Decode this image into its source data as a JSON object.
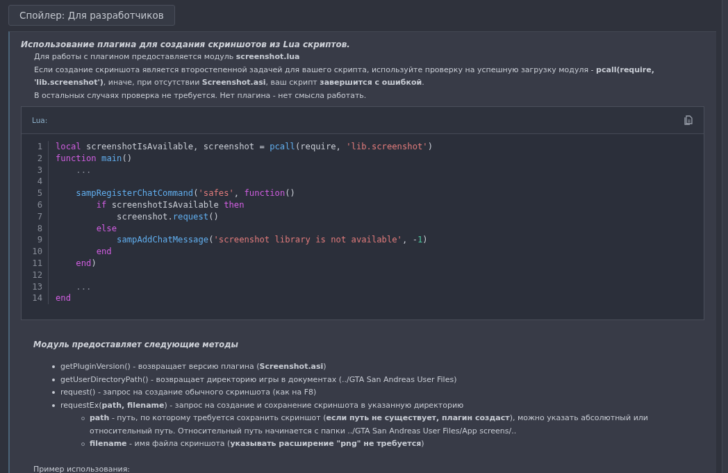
{
  "spoiler": {
    "label": "Спойлер: Для разработчиков"
  },
  "heading": "Использование плагина для создания скриншотов из Lua скриптов.",
  "paragraphs": [
    "Для работы с плагином предоставляется модуль **screenshot.lua**",
    "Если создание скриншота является второстепенной задачей для вашего скрипта, используйте проверку на успешную загрузку модуля - **pcall(require, 'lib.screenshot')**, иначе, при отсутствии **Screenshot.asi**, ваш скрипт **завершится с ошибкой**.",
    "В остальных случаях проверка не требуется. Нет плагина - нет смысла работать."
  ],
  "code": {
    "language": "Lua:",
    "lines": [
      {
        "number": "1",
        "tokens": [
          {
            "text": "local",
            "kind": "kw"
          },
          {
            "text": " screenshotIsAvailable, screenshot = ",
            "kind": "plain"
          },
          {
            "text": "pcall",
            "kind": "fn"
          },
          {
            "text": "(require, ",
            "kind": "plain"
          },
          {
            "text": "'lib.screenshot'",
            "kind": "str"
          },
          {
            "text": ")",
            "kind": "plain"
          }
        ]
      },
      {
        "number": "2",
        "tokens": [
          {
            "text": "function",
            "kind": "kw"
          },
          {
            "text": " main",
            "kind": "fn"
          },
          {
            "text": "()",
            "kind": "plain"
          }
        ]
      },
      {
        "number": "3",
        "tokens": [
          {
            "text": "    ...",
            "kind": "dim"
          }
        ]
      },
      {
        "number": "4"
      },
      {
        "number": "5",
        "tokens": [
          {
            "text": "    sampRegisterChatCommand",
            "kind": "fn"
          },
          {
            "text": "(",
            "kind": "plain"
          },
          {
            "text": "'safes'",
            "kind": "str"
          },
          {
            "text": ", ",
            "kind": "plain"
          },
          {
            "text": "function",
            "kind": "kw"
          },
          {
            "text": "()",
            "kind": "plain"
          }
        ]
      },
      {
        "number": "6",
        "tokens": [
          {
            "text": "        if",
            "kind": "kw"
          },
          {
            "text": " screenshotIsAvailable ",
            "kind": "plain"
          },
          {
            "text": "then",
            "kind": "kw"
          }
        ]
      },
      {
        "number": "7",
        "tokens": [
          {
            "text": "            screenshot.",
            "kind": "plain"
          },
          {
            "text": "request",
            "kind": "fn"
          },
          {
            "text": "()",
            "kind": "plain"
          }
        ]
      },
      {
        "number": "8",
        "tokens": [
          {
            "text": "        else",
            "kind": "kw"
          }
        ]
      },
      {
        "number": "9",
        "tokens": [
          {
            "text": "            sampAddChatMessage",
            "kind": "fn"
          },
          {
            "text": "(",
            "kind": "plain"
          },
          {
            "text": "'screenshot library is not available'",
            "kind": "str"
          },
          {
            "text": ", -",
            "kind": "plain"
          },
          {
            "text": "1",
            "kind": "num"
          },
          {
            "text": ")",
            "kind": "plain"
          }
        ]
      },
      {
        "number": "10",
        "tokens": [
          {
            "text": "        end",
            "kind": "kw"
          }
        ]
      },
      {
        "number": "11",
        "tokens": [
          {
            "text": "    end",
            "kind": "kw"
          },
          {
            "text": ")",
            "kind": "plain"
          }
        ]
      },
      {
        "number": "12"
      },
      {
        "number": "13",
        "tokens": [
          {
            "text": "    ...",
            "kind": "dim"
          }
        ]
      },
      {
        "number": "14",
        "tokens": [
          {
            "text": "end",
            "kind": "kw"
          }
        ]
      }
    ]
  },
  "methods_heading": "Модуль предоставляет следующие методы",
  "methods": [
    {
      "text": "getPluginVersion() - возвращает версию плагина (**Screenshot.asi**)"
    },
    {
      "text": "getUserDirectoryPath() - возвращает директорию игры в документах (../GTA San Andreas User Files)"
    },
    {
      "text": "request() - запрос на создание обычного скриншота (как на F8)"
    },
    {
      "text": "requestEx(**path, filename**) - запрос на создание и сохранение скриншота в указанную директорию",
      "children": [
        {
          "text": "**path** - путь, по которому требуется сохранить скриншот (**если путь не существует, плагин создаст**), можно указать абсолютный или относительный путь. Относительный путь начинается с папки ../GTA San Andreas User Files/App screens/.."
        },
        {
          "text": "**filename** - имя файла скриншота (**указывать расширение \"png\" не требуется**)"
        }
      ]
    }
  ],
  "example_label": "Пример использования:"
}
